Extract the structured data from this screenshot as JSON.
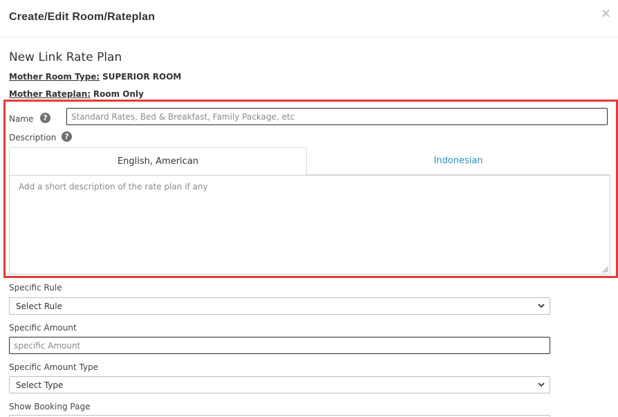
{
  "modal": {
    "title": "Create/Edit Room/Rateplan",
    "close_glyph": "×"
  },
  "section": {
    "title": "New Link Rate Plan",
    "mother_room_type_label": "Mother Room Type:",
    "mother_room_type_value": "SUPERIOR ROOM",
    "mother_rateplan_label": "Mother Rateplan:",
    "mother_rateplan_value": "Room Only"
  },
  "form": {
    "name_label": "Name",
    "name_placeholder": "Standard Rates, Bed & Breakfast, Family Package, etc",
    "description_label": "Description",
    "help_glyph": "?",
    "tabs": [
      {
        "label": "English, American",
        "active": true
      },
      {
        "label": "Indonesian",
        "active": false
      }
    ],
    "description_placeholder": "Add a short description of the rate plan if any",
    "specific_rule_label": "Specific Rule",
    "specific_rule_value": "Select Rule",
    "specific_amount_label": "Specific Amount",
    "specific_amount_placeholder": "specific Amount",
    "specific_amount_type_label": "Specific Amount Type",
    "specific_amount_type_value": "Select Type",
    "show_booking_page_label": "Show Booking Page"
  },
  "icons": {
    "close": "close-icon",
    "help": "question-circle-icon",
    "select_arrow": "chevron-down-icon"
  },
  "colors": {
    "highlight": "#e53935",
    "link_tab": "#2a8fbd"
  }
}
